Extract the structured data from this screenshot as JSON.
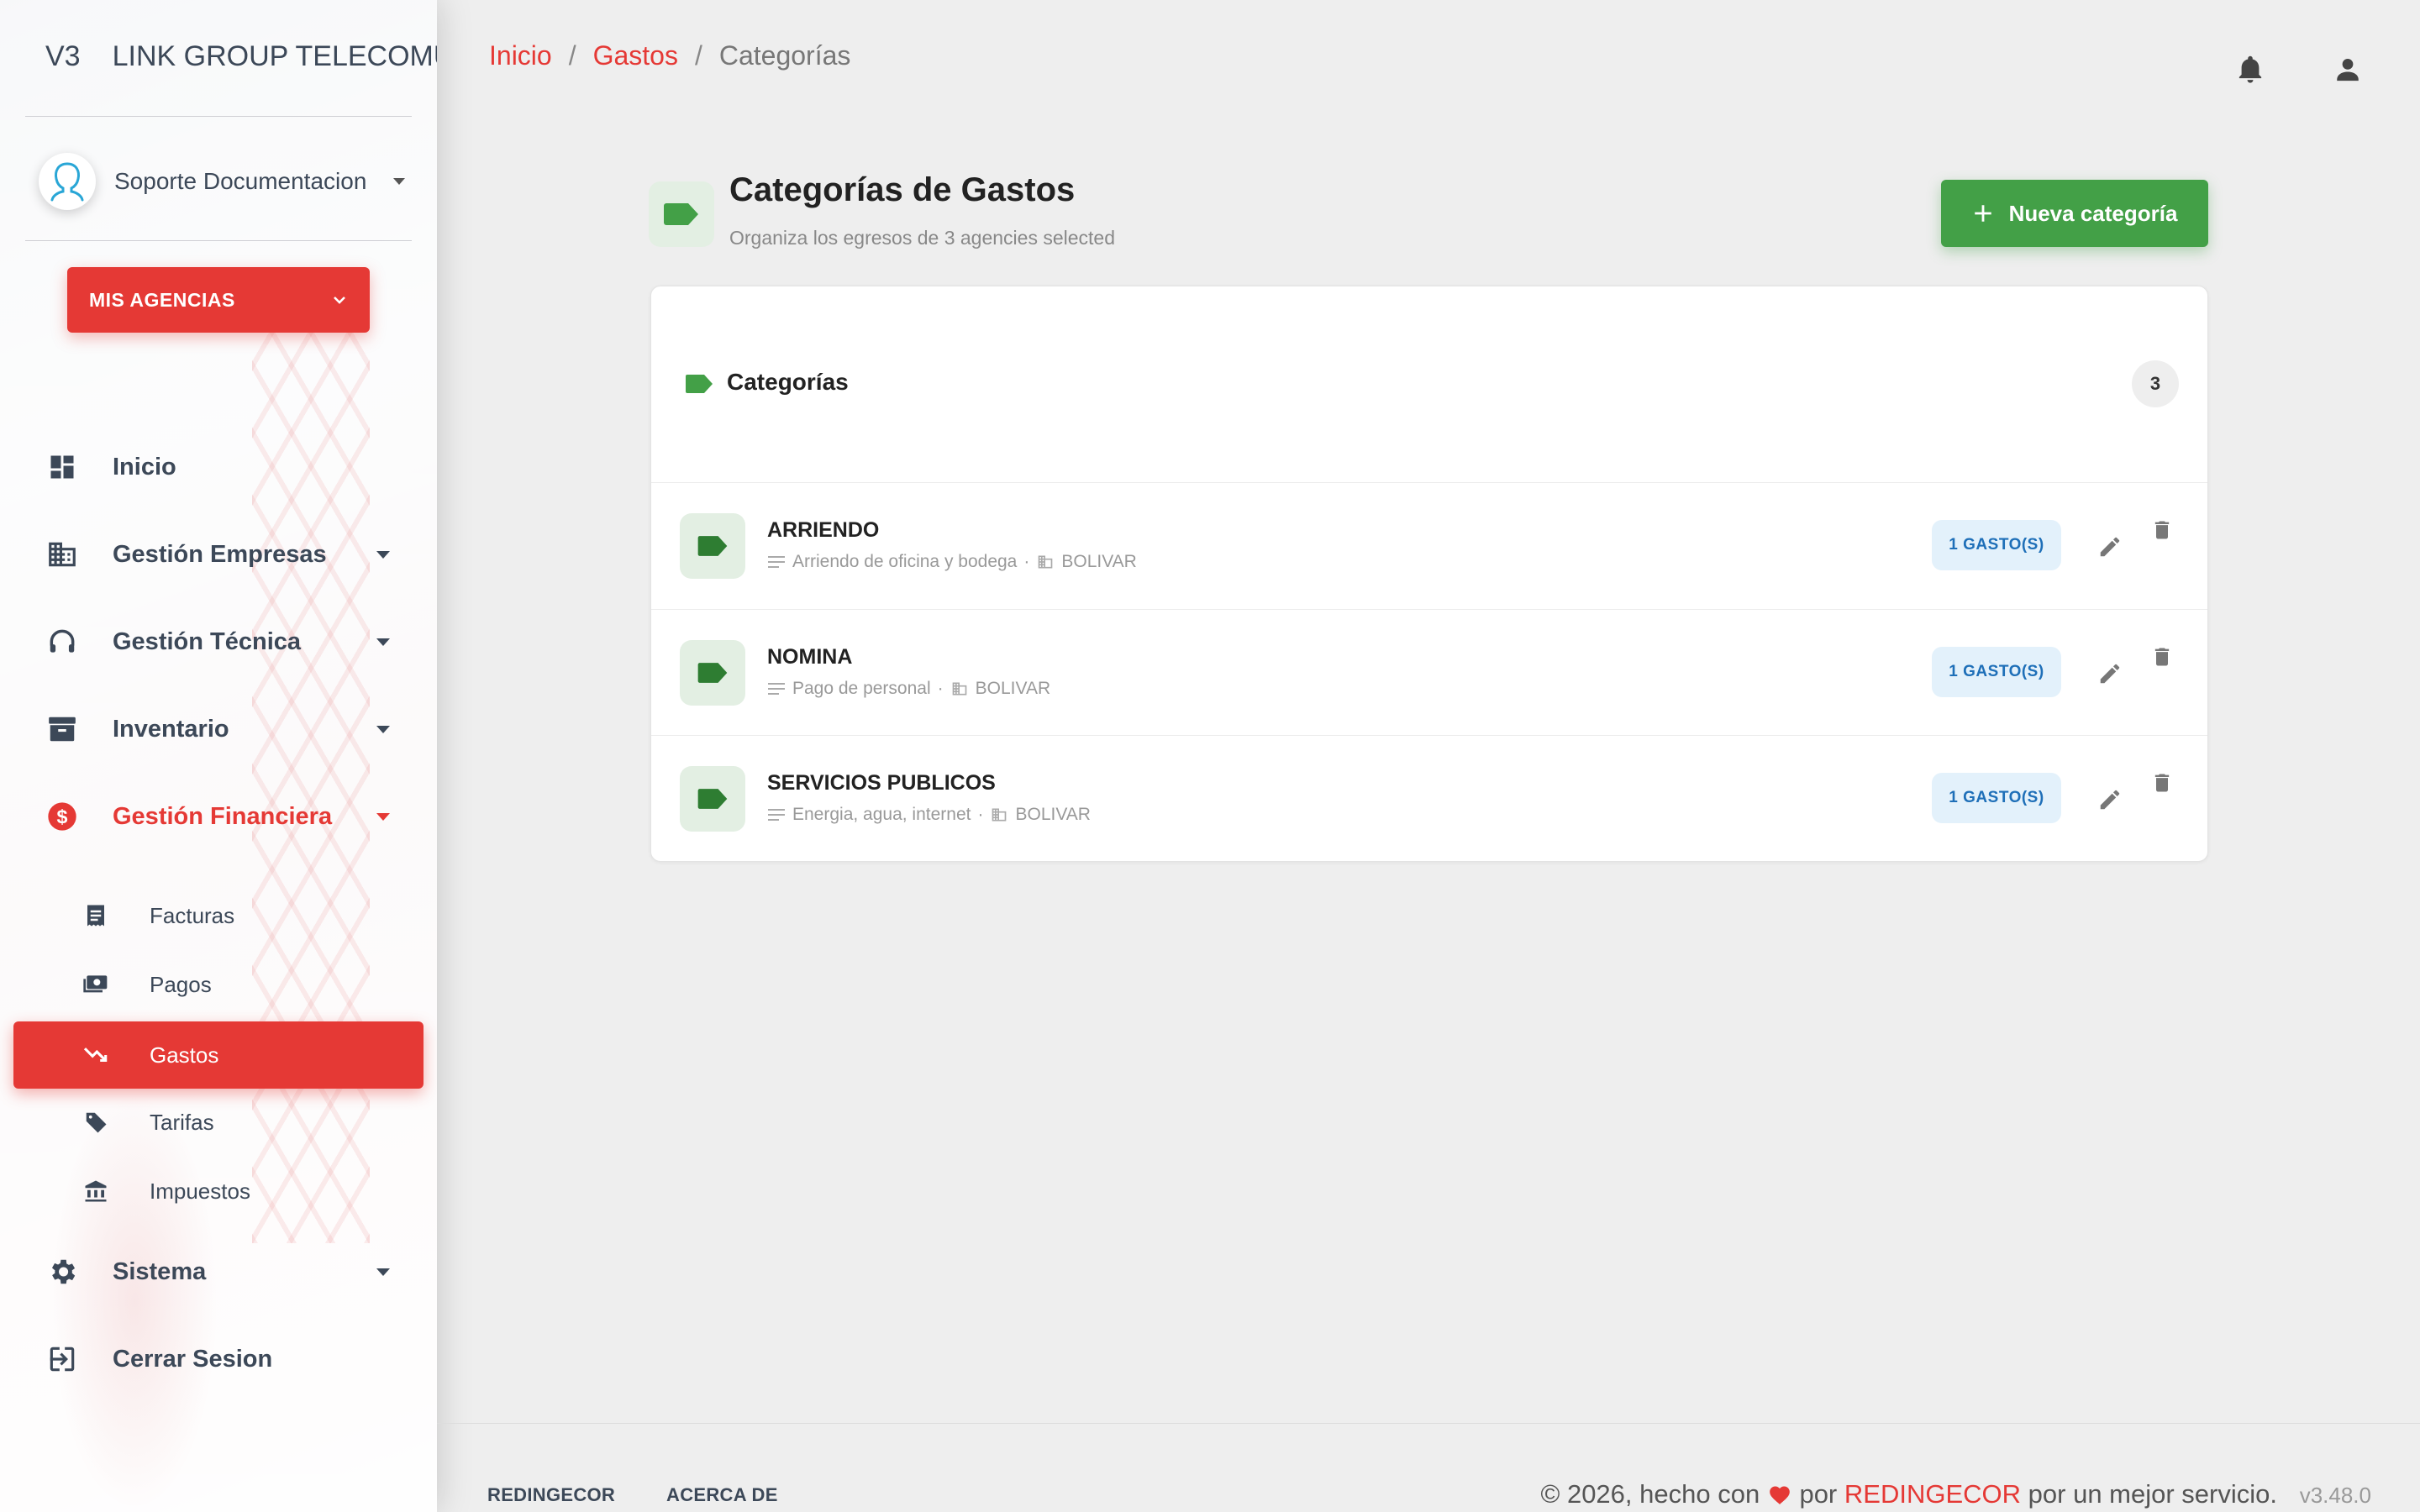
{
  "app": {
    "brand_mini": "V3",
    "brand_name": "LINK GROUP TELECOMU"
  },
  "user": {
    "name": "Soporte Documentacion"
  },
  "agencies_button": {
    "label": "MIS AGENCIAS"
  },
  "sidebar": {
    "items": [
      {
        "label": "Inicio",
        "icon": "dashboard-icon"
      },
      {
        "label": "Gestión Empresas",
        "icon": "building-icon"
      },
      {
        "label": "Gestión Técnica",
        "icon": "headset-icon"
      },
      {
        "label": "Inventario",
        "icon": "archive-icon"
      },
      {
        "label": "Gestión Financiera",
        "icon": "dollar-icon"
      },
      {
        "label": "Sistema",
        "icon": "gear-icon"
      },
      {
        "label": "Cerrar Sesion",
        "icon": "logout-icon"
      }
    ],
    "sub_items": [
      {
        "label": "Facturas",
        "icon": "receipt-icon"
      },
      {
        "label": "Pagos",
        "icon": "payments-icon"
      },
      {
        "label": "Gastos",
        "icon": "trending-down-icon"
      },
      {
        "label": "Tarifas",
        "icon": "tag-icon"
      },
      {
        "label": "Impuestos",
        "icon": "bank-icon"
      }
    ]
  },
  "breadcrumb": {
    "home": "Inicio",
    "section": "Gastos",
    "current": "Categorías",
    "separator": "/"
  },
  "header": {
    "title": "Categorías de Gastos",
    "subtitle": "Organiza los egresos de 3 agencies selected",
    "new_button": "Nueva categoría"
  },
  "card": {
    "title": "Categorías",
    "count": "3",
    "rows": [
      {
        "name": "ARRIENDO",
        "description": "Arriendo de oficina y bodega",
        "agency": "BOLIVAR",
        "badge": "1 GASTO(S)"
      },
      {
        "name": "NOMINA",
        "description": "Pago de personal",
        "agency": "BOLIVAR",
        "badge": "1 GASTO(S)"
      },
      {
        "name": "SERVICIOS PUBLICOS",
        "description": "Energia, agua, internet",
        "agency": "BOLIVAR",
        "badge": "1 GASTO(S)"
      }
    ]
  },
  "footer": {
    "link1": "REDINGECOR",
    "link2": "ACERCA DE",
    "copy_prefix": "© 2026, hecho con",
    "copy_by": "por",
    "copy_brand": "REDINGECOR",
    "copy_suffix": "por un mejor servicio.",
    "version": "v3.48.0"
  },
  "colors": {
    "accent": "#e53935",
    "success": "#43a047",
    "tag_green": "#2e7d32",
    "badge_blue": "#1e6fb8"
  }
}
